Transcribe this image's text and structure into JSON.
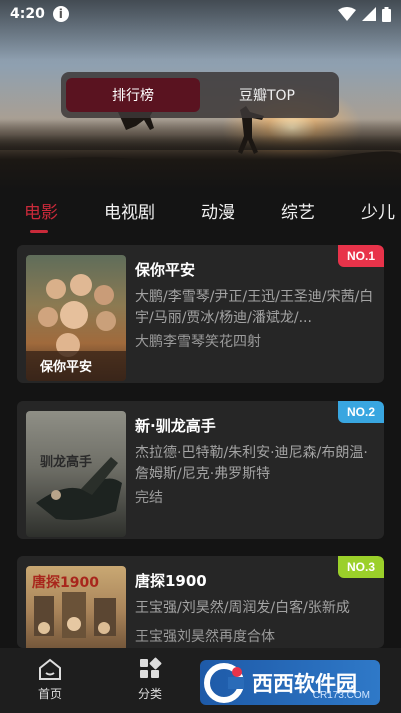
{
  "status_bar": {
    "time": "4:20",
    "info_glyph": "i"
  },
  "segment": {
    "items": [
      "排行榜",
      "豆瓣TOP"
    ],
    "active_index": 0
  },
  "tabs": [
    "电影",
    "电视剧",
    "动漫",
    "综艺",
    "少儿"
  ],
  "active_tab": "电影",
  "cards": [
    {
      "title": "保你平安",
      "cast": "大鹏/李雪琴/尹正/王迅/王圣迪/宋茜/白宇/马丽/贾冰/杨迪/潘斌龙/...",
      "desc": "大鹏李雪琴笑花四射",
      "rank": "NO.1",
      "rank_color": "#e8334a",
      "poster_text": "保你平安"
    },
    {
      "title": "新·驯龙高手",
      "cast": "杰拉德·巴特勒/朱利安·迪尼森/布朗温·詹姆斯/尼克·弗罗斯特",
      "desc": "完结",
      "rank": "NO.2",
      "rank_color": "#39a6e0",
      "poster_text": "驯龙高手"
    },
    {
      "title": "唐探1900",
      "cast": "王宝强/刘昊然/周润发/白客/张新成",
      "desc": "王宝强刘昊然再度合体",
      "rank": "NO.3",
      "rank_color": "#9bd02a",
      "poster_text": "唐探1900"
    }
  ],
  "bottom_nav": [
    {
      "label": "首页",
      "icon": "home-icon"
    },
    {
      "label": "分类",
      "icon": "category-icon"
    }
  ],
  "watermark": {
    "text": "西西软件园",
    "site": "CR173.COM"
  }
}
